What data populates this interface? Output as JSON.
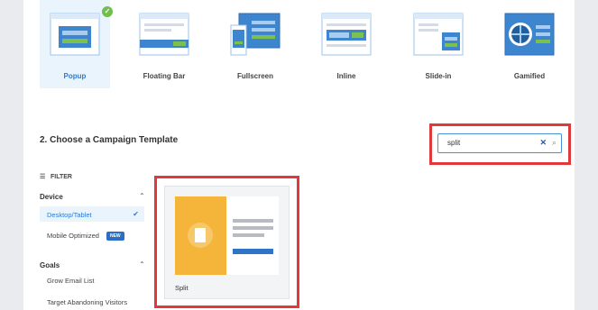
{
  "campaign_types": [
    {
      "label": "Popup",
      "selected": true
    },
    {
      "label": "Floating Bar",
      "selected": false
    },
    {
      "label": "Fullscreen",
      "selected": false
    },
    {
      "label": "Inline",
      "selected": false
    },
    {
      "label": "Slide-in",
      "selected": false
    },
    {
      "label": "Gamified",
      "selected": false
    }
  ],
  "section": {
    "title": "2. Choose a Campaign Template"
  },
  "search": {
    "value": "split",
    "clear_icon": "close-icon",
    "search_icon": "search-icon"
  },
  "filter": {
    "label": "FILTER"
  },
  "device": {
    "heading": "Device",
    "options": [
      {
        "label": "Desktop/Tablet",
        "active": true
      },
      {
        "label": "Mobile Optimized",
        "badge": "NEW"
      }
    ]
  },
  "goals": {
    "heading": "Goals",
    "options": [
      {
        "label": "Grow Email List"
      },
      {
        "label": "Target Abandoning Visitors"
      }
    ]
  },
  "template": {
    "name": "Split"
  },
  "colors": {
    "accent": "#2b7cd3",
    "highlight": "#e0393c",
    "check": "#6fbf4a",
    "template_yellow": "#f4b53a"
  }
}
